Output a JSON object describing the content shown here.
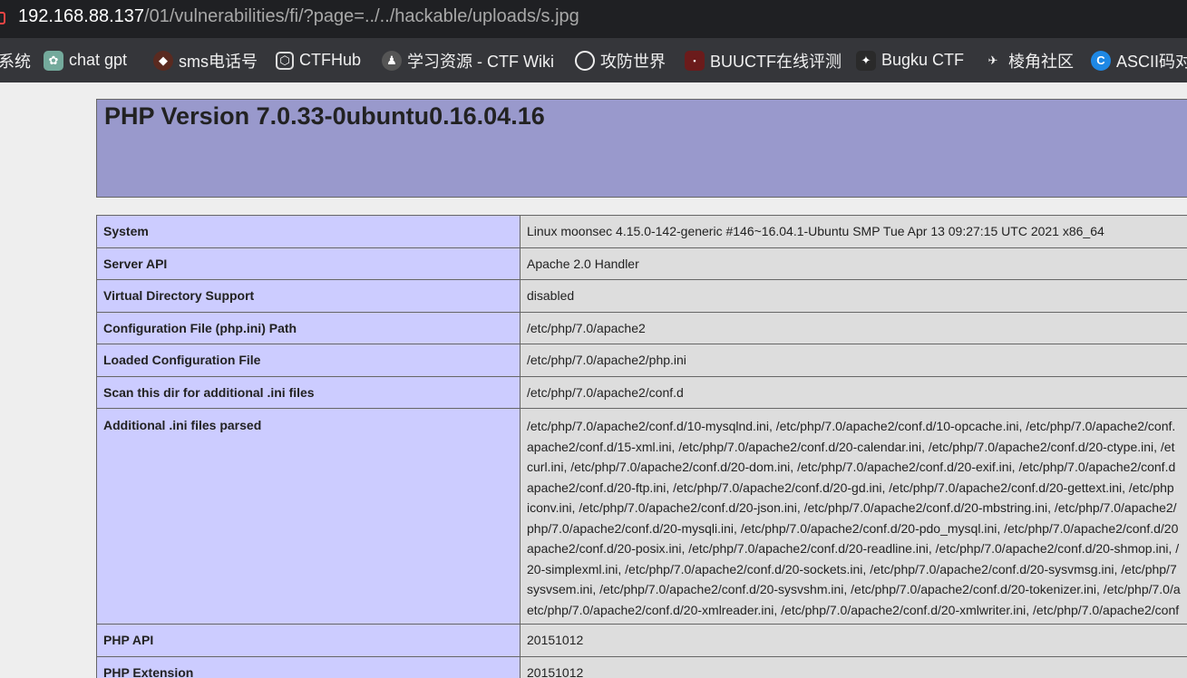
{
  "address_bar": {
    "url_host": "192.168.88.137",
    "url_path": "/01/vulnerabilities/fi/?page=../../hackable/uploads/s.jpg"
  },
  "bookmarks": [
    {
      "label": "系统",
      "icon": "none"
    },
    {
      "label": "chat gpt",
      "icon": "chatgpt-icon"
    },
    {
      "label": "sms电话号",
      "icon": "sms-icon"
    },
    {
      "label": "CTFHub",
      "icon": "ctfhub-icon"
    },
    {
      "label": "学习资源 - CTF Wiki",
      "icon": "ctfwiki-icon"
    },
    {
      "label": "攻防世界",
      "icon": "globe-icon"
    },
    {
      "label": "BUUCTF在线评测",
      "icon": "buuctf-icon"
    },
    {
      "label": "Bugku CTF",
      "icon": "bugku-icon"
    },
    {
      "label": "棱角社区",
      "icon": "lengjiao-icon"
    },
    {
      "label": "ASCII码对",
      "icon": "ascii-icon"
    }
  ],
  "phpinfo": {
    "title": "PHP Version 7.0.33-0ubuntu0.16.04.16",
    "rows": [
      {
        "key": "System",
        "value": "Linux moonsec 4.15.0-142-generic #146~16.04.1-Ubuntu SMP Tue Apr 13 09:27:15 UTC 2021 x86_64"
      },
      {
        "key": "Server API",
        "value": "Apache 2.0 Handler"
      },
      {
        "key": "Virtual Directory Support",
        "value": "disabled"
      },
      {
        "key": "Configuration File (php.ini) Path",
        "value": "/etc/php/7.0/apache2"
      },
      {
        "key": "Loaded Configuration File",
        "value": "/etc/php/7.0/apache2/php.ini"
      },
      {
        "key": "Scan this dir for additional .ini files",
        "value": "/etc/php/7.0/apache2/conf.d"
      }
    ],
    "ini_parsed": {
      "key": "Additional .ini files parsed",
      "lines": [
        "/etc/php/7.0/apache2/conf.d/10-mysqlnd.ini, /etc/php/7.0/apache2/conf.d/10-opcache.ini, /etc/php/7.0/apache2/conf.",
        "apache2/conf.d/15-xml.ini, /etc/php/7.0/apache2/conf.d/20-calendar.ini, /etc/php/7.0/apache2/conf.d/20-ctype.ini, /et",
        "curl.ini, /etc/php/7.0/apache2/conf.d/20-dom.ini, /etc/php/7.0/apache2/conf.d/20-exif.ini, /etc/php/7.0/apache2/conf.d",
        "apache2/conf.d/20-ftp.ini, /etc/php/7.0/apache2/conf.d/20-gd.ini, /etc/php/7.0/apache2/conf.d/20-gettext.ini, /etc/php",
        "iconv.ini, /etc/php/7.0/apache2/conf.d/20-json.ini, /etc/php/7.0/apache2/conf.d/20-mbstring.ini, /etc/php/7.0/apache2/",
        "php/7.0/apache2/conf.d/20-mysqli.ini, /etc/php/7.0/apache2/conf.d/20-pdo_mysql.ini, /etc/php/7.0/apache2/conf.d/20",
        "apache2/conf.d/20-posix.ini, /etc/php/7.0/apache2/conf.d/20-readline.ini, /etc/php/7.0/apache2/conf.d/20-shmop.ini, /",
        "20-simplexml.ini, /etc/php/7.0/apache2/conf.d/20-sockets.ini, /etc/php/7.0/apache2/conf.d/20-sysvmsg.ini, /etc/php/7",
        "sysvsem.ini, /etc/php/7.0/apache2/conf.d/20-sysvshm.ini, /etc/php/7.0/apache2/conf.d/20-tokenizer.ini, /etc/php/7.0/a",
        "etc/php/7.0/apache2/conf.d/20-xmlreader.ini, /etc/php/7.0/apache2/conf.d/20-xmlwriter.ini, /etc/php/7.0/apache2/conf"
      ]
    },
    "rows_after": [
      {
        "key": "PHP API",
        "value": "20151012"
      },
      {
        "key": "PHP Extension",
        "value": "20151012"
      }
    ]
  }
}
